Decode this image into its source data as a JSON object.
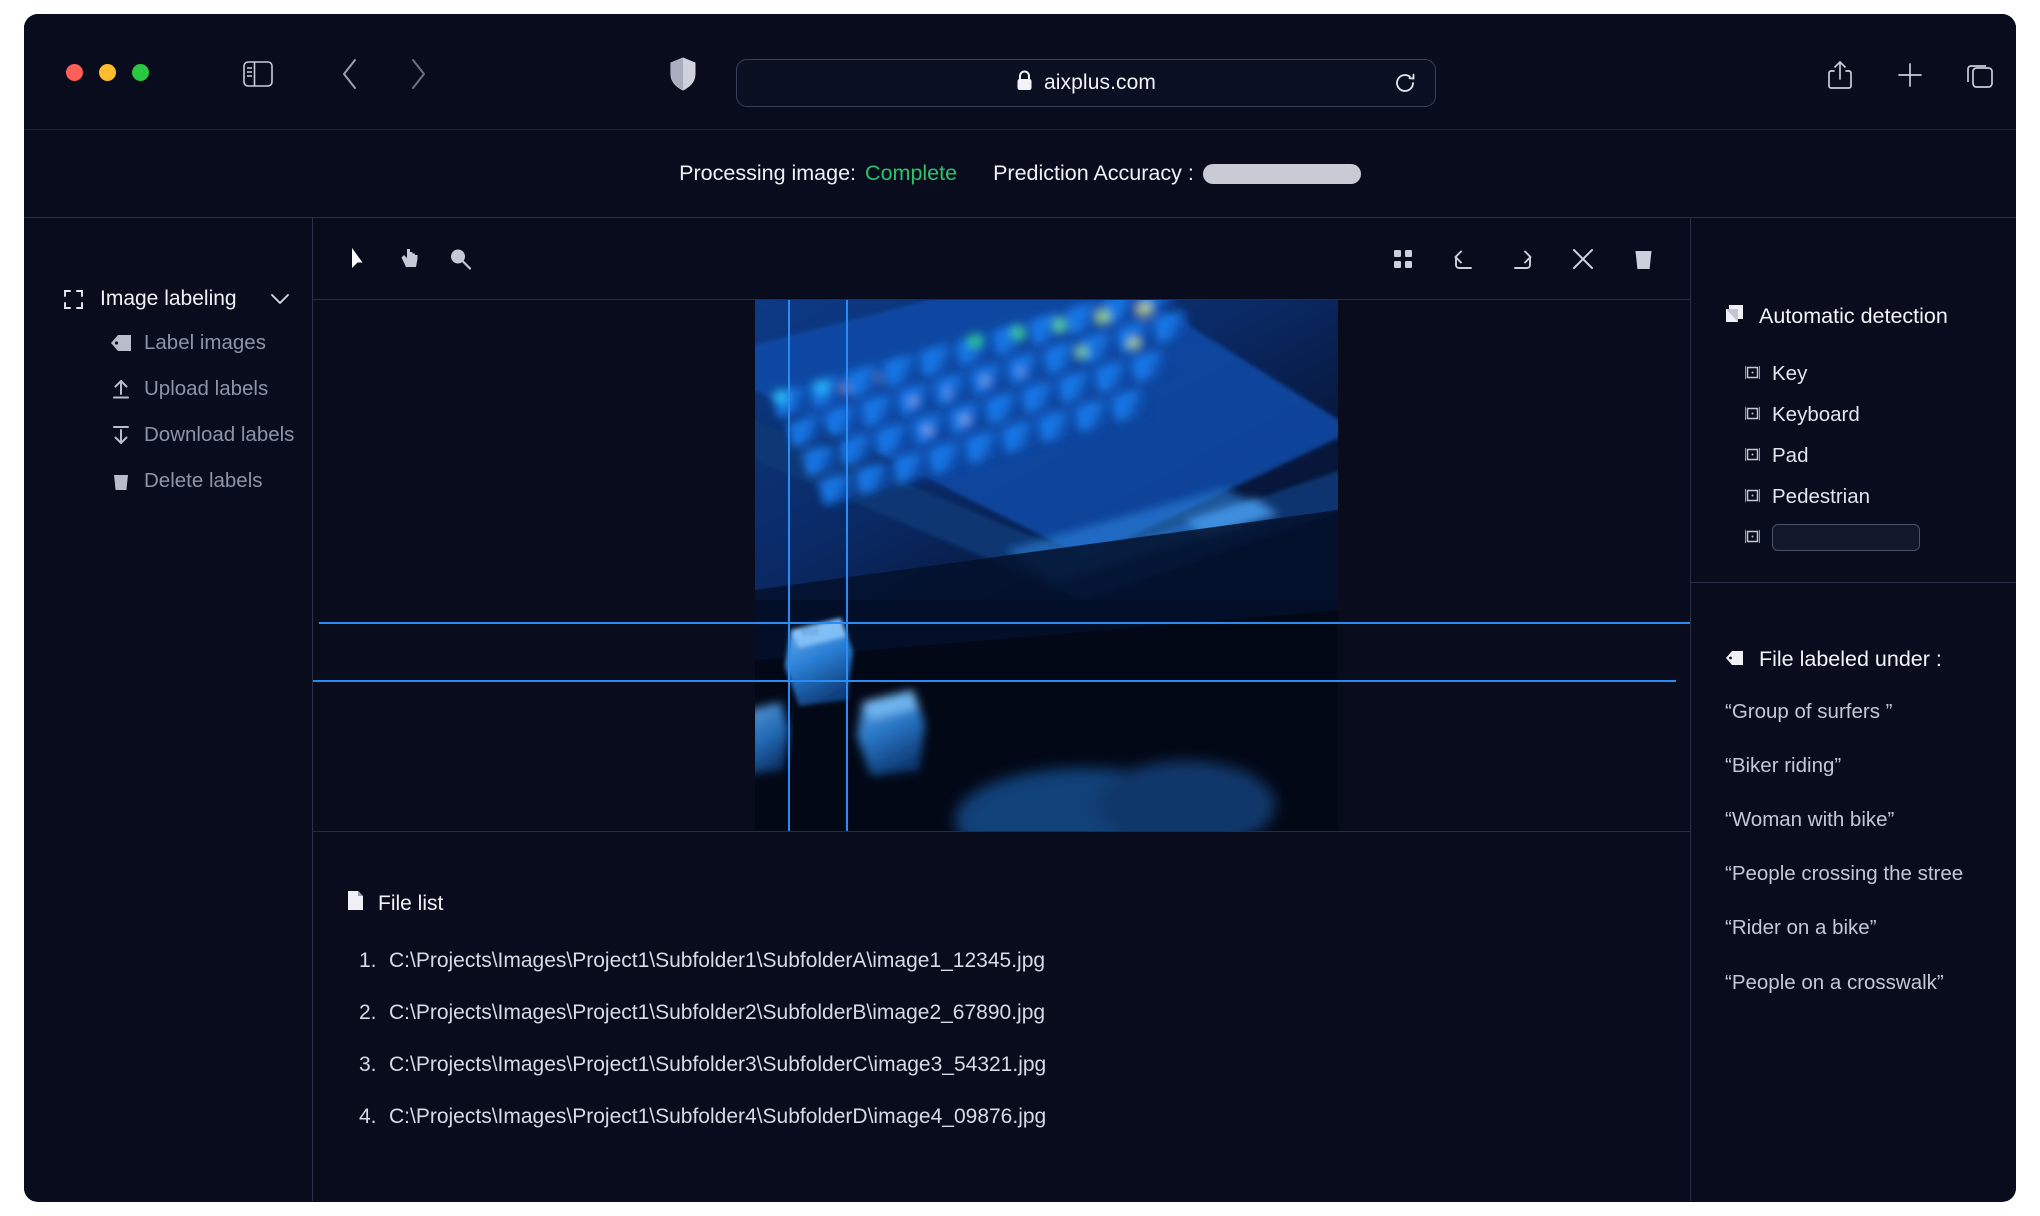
{
  "browser": {
    "url": "aixplus.com",
    "icons": {
      "sidebar_toggle": "sidebar-toggle-icon",
      "back": "chevron-left-icon",
      "forward": "chevron-right-icon",
      "shield": "shield-icon",
      "lock": "lock-icon",
      "reload": "reload-icon",
      "share": "share-icon",
      "new_tab": "plus-icon",
      "tabs": "tabs-icon"
    }
  },
  "status": {
    "processing_label": "Processing image:",
    "processing_value": "Complete",
    "accuracy_label": "Prediction Accuracy :",
    "accuracy_percent": 93,
    "accent_green": "#21b563",
    "complete_color": "#2dc26b"
  },
  "sidebar": {
    "header": "Image labeling",
    "items": [
      {
        "label": "Label images",
        "icon": "tag-icon"
      },
      {
        "label": "Upload labels",
        "icon": "upload-arrow-icon"
      },
      {
        "label": "Download labels",
        "icon": "download-arrow-icon"
      },
      {
        "label": "Delete labels",
        "icon": "trash-icon"
      }
    ]
  },
  "toolbar": {
    "left": [
      {
        "name": "cursor-tool",
        "icon": "cursor-arrow-icon"
      },
      {
        "name": "pan-tool",
        "icon": "hand-pointer-icon"
      },
      {
        "name": "zoom-tool",
        "icon": "magnifier-icon"
      }
    ],
    "right": [
      {
        "name": "grid-toggle",
        "icon": "grid-icon"
      },
      {
        "name": "undo-button",
        "icon": "undo-arrow-icon"
      },
      {
        "name": "redo-button",
        "icon": "redo-arrow-icon"
      },
      {
        "name": "close-button",
        "icon": "close-x-icon"
      },
      {
        "name": "delete-button",
        "icon": "trash-icon"
      }
    ]
  },
  "canvas": {
    "image_alt": "backlit blue mechanical keyboard with loose keycaps",
    "guide_color": "#2a8bf2",
    "guides": {
      "vertical_x": [
        33,
        91
      ],
      "horizontal_y": [
        322,
        380
      ]
    }
  },
  "file_list": {
    "title": "File list",
    "icon": "file-icon",
    "files": [
      {
        "n": "1.",
        "path": "C:\\Projects\\Images\\Project1\\Subfolder1\\SubfolderA\\image1_12345.jpg"
      },
      {
        "n": "2.",
        "path": "C:\\Projects\\Images\\Project1\\Subfolder2\\SubfolderB\\image2_67890.jpg"
      },
      {
        "n": "3.",
        "path": "C:\\Projects\\Images\\Project1\\Subfolder3\\SubfolderC\\image3_54321.jpg"
      },
      {
        "n": "4.",
        "path": "C:\\Projects\\Images\\Project1\\Subfolder4\\SubfolderD\\image4_09876.jpg"
      }
    ]
  },
  "detection": {
    "title": "Automatic detection",
    "icon": "layers-icon",
    "items": [
      {
        "label": "Key",
        "icon": "bbox-icon"
      },
      {
        "label": "Keyboard",
        "icon": "bbox-icon"
      },
      {
        "label": "Pad",
        "icon": "bbox-icon"
      },
      {
        "label": "Pedestrian",
        "icon": "bbox-icon"
      }
    ],
    "new_entry": {
      "icon": "bbox-icon",
      "value": "",
      "placeholder": ""
    }
  },
  "labeled_under": {
    "title": "File labeled under :",
    "icon": "tag-icon",
    "labels": [
      "“Group of surfers ”",
      "“Biker riding”",
      "“Woman with bike”",
      "“People crossing the stree",
      "“Rider on a bike”",
      "“People on a crosswalk”"
    ]
  }
}
